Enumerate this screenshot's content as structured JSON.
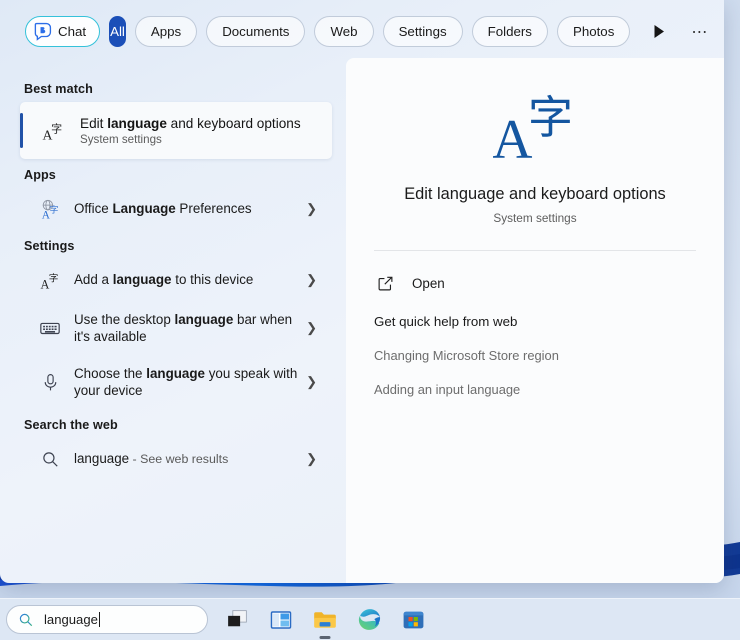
{
  "tabs": {
    "chat": "Chat",
    "items": [
      "All",
      "Apps",
      "Documents",
      "Web",
      "Settings",
      "Folders",
      "Photos"
    ],
    "play_icon": "play-arrow-icon",
    "more_icon": "ellipsis-icon",
    "avatar_icon": "bing-chat-icon"
  },
  "results": {
    "best_match_heading": "Best match",
    "best_match": {
      "title_pre": "Edit ",
      "title_hl": "language",
      "title_post": " and keyboard options",
      "subtitle": "System settings",
      "icon": "language-translate-icon"
    },
    "apps_heading": "Apps",
    "apps": [
      {
        "pre": "Office ",
        "hl": "Language",
        "post": " Preferences",
        "icon": "globe-language-icon",
        "chevron": "chevron-right-icon"
      }
    ],
    "settings_heading": "Settings",
    "settings": [
      {
        "pre": "Add a ",
        "hl": "language",
        "post": " to this device",
        "icon": "language-translate-icon",
        "chevron": "chevron-right-icon"
      },
      {
        "pre": "Use the desktop ",
        "hl": "language",
        "post": " bar when it's available",
        "icon": "keyboard-icon",
        "chevron": "chevron-right-icon"
      },
      {
        "pre": "Choose the ",
        "hl": "language",
        "post": " you speak with your device",
        "icon": "microphone-icon",
        "chevron": "chevron-right-icon"
      }
    ],
    "web_heading": "Search the web",
    "web": {
      "query": "language",
      "suffix": " - See web results",
      "icon": "search-icon",
      "chevron": "chevron-right-icon"
    }
  },
  "preview": {
    "icon": "language-translate-icon",
    "title": "Edit language and keyboard options",
    "subtitle": "System settings",
    "open_label": "Open",
    "open_icon": "external-link-icon",
    "quick_help_heading": "Get quick help from web",
    "links": [
      "Changing Microsoft Store region",
      "Adding an input language"
    ]
  },
  "taskbar": {
    "search_value": "language",
    "search_icon": "search-icon",
    "icons": [
      "task-view-icon",
      "widgets-icon",
      "file-explorer-icon",
      "edge-browser-icon",
      "microsoft-store-icon"
    ]
  },
  "colors": {
    "accent_blue": "#1b4fb8",
    "chat_border": "#35c2da",
    "selection_bar": "#2152a8",
    "preview_icon": "#1456a0"
  }
}
